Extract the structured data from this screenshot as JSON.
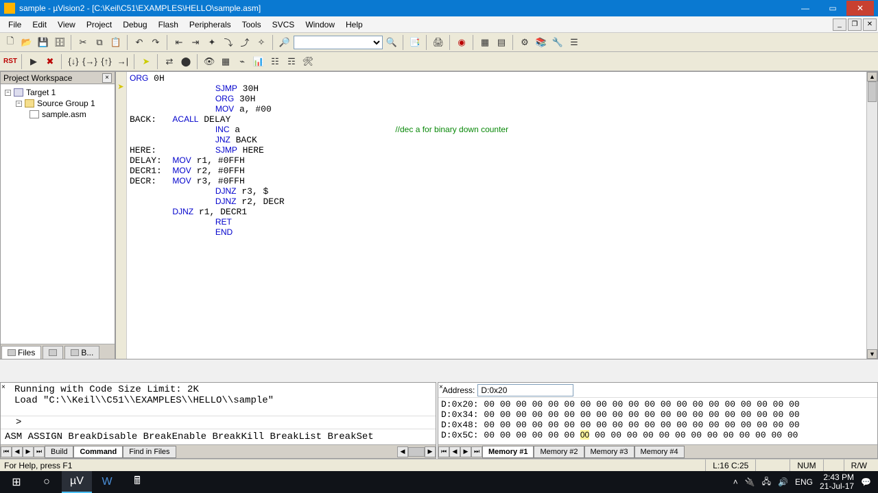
{
  "window": {
    "title": "sample  - µVision2 - [C:\\Keil\\C51\\EXAMPLES\\HELLO\\sample.asm]"
  },
  "menu": {
    "items": [
      "File",
      "Edit",
      "View",
      "Project",
      "Debug",
      "Flash",
      "Peripherals",
      "Tools",
      "SVCS",
      "Window",
      "Help"
    ]
  },
  "workspace": {
    "title": "Project Workspace",
    "tree": {
      "root": "Target 1",
      "group": "Source Group 1",
      "file": "sample.asm"
    },
    "tabs": [
      "Files",
      "",
      "B..."
    ]
  },
  "editor": {
    "lines": [
      {
        "pre": "",
        "code": "ORG",
        "rest": " 0H"
      },
      {
        "pre": "                ",
        "code": "SJMP",
        "rest": " 30H"
      },
      {
        "pre": "                ",
        "code": "ORG",
        "rest": " 30H"
      },
      {
        "pre": "                ",
        "code": "MOV",
        "rest": " a, #00"
      },
      {
        "pre": "BACK:   ",
        "code": "ACALL",
        "rest": " DELAY"
      },
      {
        "pre": "                ",
        "code": "INC",
        "rest": " a                             ",
        "comment": "//dec a for binary down counter"
      },
      {
        "pre": "                ",
        "code": "JNZ",
        "rest": " BACK"
      },
      {
        "pre": "HERE:           ",
        "code": "SJMP",
        "rest": " HERE"
      },
      {
        "pre": "DELAY:  ",
        "code": "MOV",
        "rest": " r1, #0FFH"
      },
      {
        "pre": "DECR1:  ",
        "code": "MOV",
        "rest": " r2, #0FFH"
      },
      {
        "pre": "DECR:   ",
        "code": "MOV",
        "rest": " r3, #0FFH"
      },
      {
        "pre": "                ",
        "code": "DJNZ",
        "rest": " r3, $"
      },
      {
        "pre": "                ",
        "code": "DJNZ",
        "rest": " r2, DECR"
      },
      {
        "pre": "        ",
        "code": "DJNZ",
        "rest": " r1, DECR1"
      },
      {
        "pre": "                ",
        "code": "RET",
        "rest": ""
      },
      {
        "pre": "                ",
        "code": "END",
        "rest": ""
      }
    ]
  },
  "output": {
    "text": "Running with Code Size Limit: 2K\nLoad \"C:\\\\Keil\\\\C51\\\\EXAMPLES\\\\HELLO\\\\sample\"",
    "prompt": ">",
    "commands": "ASM ASSIGN BreakDisable BreakEnable BreakKill BreakList BreakSet",
    "tabs": [
      "Build",
      "Command",
      "Find in Files"
    ]
  },
  "memory": {
    "address_label": "Address:",
    "address_value": "D:0x20",
    "rows": [
      {
        "addr": "D:0x20:",
        "bytes": [
          "00",
          "00",
          "00",
          "00",
          "00",
          "00",
          "00",
          "00",
          "00",
          "00",
          "00",
          "00",
          "00",
          "00",
          "00",
          "00",
          "00",
          "00",
          "00",
          "00"
        ]
      },
      {
        "addr": "D:0x34:",
        "bytes": [
          "00",
          "00",
          "00",
          "00",
          "00",
          "00",
          "00",
          "00",
          "00",
          "00",
          "00",
          "00",
          "00",
          "00",
          "00",
          "00",
          "00",
          "00",
          "00",
          "00"
        ]
      },
      {
        "addr": "D:0x48:",
        "bytes": [
          "00",
          "00",
          "00",
          "00",
          "00",
          "00",
          "00",
          "00",
          "00",
          "00",
          "00",
          "00",
          "00",
          "00",
          "00",
          "00",
          "00",
          "00",
          "00",
          "00"
        ]
      },
      {
        "addr": "D:0x5C:",
        "bytes": [
          "00",
          "00",
          "00",
          "00",
          "00",
          "00",
          "00",
          "00",
          "00",
          "00",
          "00",
          "00",
          "00",
          "00",
          "00",
          "00",
          "00",
          "00",
          "00",
          "00"
        ],
        "highlight": 6
      }
    ],
    "tabs": [
      "Memory #1",
      "Memory #2",
      "Memory #3",
      "Memory #4"
    ]
  },
  "status": {
    "help": "For Help, press F1",
    "pos": "L:16 C:25",
    "num": "NUM",
    "rw": "R/W"
  },
  "taskbar": {
    "lang": "ENG",
    "time": "2:43 PM",
    "date": "21-Jul-17"
  }
}
